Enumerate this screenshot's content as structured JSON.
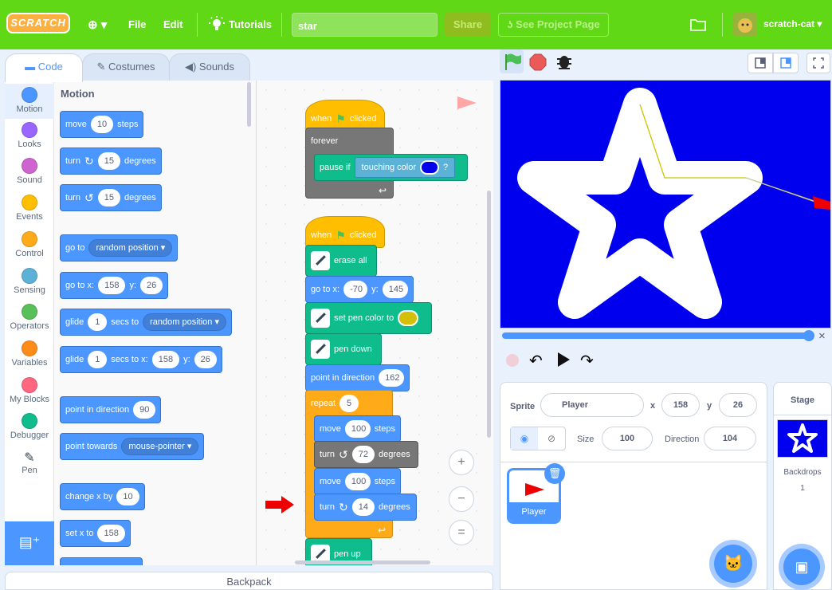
{
  "menubar": {
    "logo": "SCRATCH",
    "globe": "⊕ ▾",
    "file": "File",
    "edit": "Edit",
    "tutorials": "Tutorials",
    "project_title": "star",
    "share": "Share",
    "see_project_page": "See Project Page",
    "username": "scratch-cat ▾"
  },
  "tabs": {
    "code": "Code",
    "costumes": "Costumes",
    "sounds": "Sounds"
  },
  "categories": [
    {
      "label": "Motion",
      "color": "#4c97ff"
    },
    {
      "label": "Looks",
      "color": "#9966ff"
    },
    {
      "label": "Sound",
      "color": "#cf63cf"
    },
    {
      "label": "Events",
      "color": "#ffbf00"
    },
    {
      "label": "Control",
      "color": "#ffab19"
    },
    {
      "label": "Sensing",
      "color": "#5cb1d6"
    },
    {
      "label": "Operators",
      "color": "#59c059"
    },
    {
      "label": "Variables",
      "color": "#ff8c1a"
    },
    {
      "label": "My Blocks",
      "color": "#ff6680"
    },
    {
      "label": "Debugger",
      "color": "#0fbd8c"
    },
    {
      "label": "Pen",
      "color": "#0fbd8c"
    }
  ],
  "palette": {
    "heading": "Motion",
    "b_move": "move",
    "b_move_v": "10",
    "b_steps": "steps",
    "b_turn": "turn",
    "b_turn_r_v": "15",
    "b_degrees": "degrees",
    "b_turn_l_v": "15",
    "b_goto": "go to",
    "b_goto_dd": "random position",
    "b_gotoxy": "go to x:",
    "b_gotoxy_x": "158",
    "b_y": "y:",
    "b_gotoxy_y": "26",
    "b_glide": "glide",
    "b_glide_v": "1",
    "b_secs_to": "secs to",
    "b_glide_dd": "random position",
    "b_glide2_v": "1",
    "b_secs_to_x": "secs to x:",
    "b_glide2_x": "158",
    "b_glide2_y": "26",
    "b_point_dir": "point in direction",
    "b_point_dir_v": "90",
    "b_point_towards": "point towards",
    "b_point_towards_dd": "mouse-pointer",
    "b_change_x": "change x by",
    "b_change_x_v": "10",
    "b_set_x": "set x to",
    "b_set_x_v": "158"
  },
  "script": {
    "when_clicked": "when",
    "clicked": "clicked",
    "forever": "forever",
    "pause_if": "pause if",
    "touching_color": "touching color",
    "q": "?",
    "erase_all": "erase all",
    "goto_xy": "go to x:",
    "goto_x": "-70",
    "y": "y:",
    "goto_y": "145",
    "set_pen_color": "set pen color to",
    "pen_down": "pen down",
    "point_dir": "point in direction",
    "point_dir_v": "162",
    "repeat": "repeat",
    "repeat_v": "5",
    "move": "move",
    "move1_v": "100",
    "steps": "steps",
    "turn": "turn",
    "turn1_v": "72",
    "degrees": "degrees",
    "move2_v": "100",
    "turn2_v": "14",
    "pen_up": "pen up"
  },
  "zoom": {
    "in": "+",
    "out": "−",
    "reset": "="
  },
  "sprite": {
    "label": "Sprite",
    "name": "Player",
    "x_label": "x",
    "x": "158",
    "y_label": "y",
    "y": "26",
    "size_label": "Size",
    "size": "100",
    "direction_label": "Direction",
    "direction": "104",
    "thumb_name": "Player"
  },
  "stage": {
    "title": "Stage",
    "backdrops_label": "Backdrops",
    "backdrops_count": "1"
  },
  "backpack": "Backpack",
  "close_x": "×"
}
